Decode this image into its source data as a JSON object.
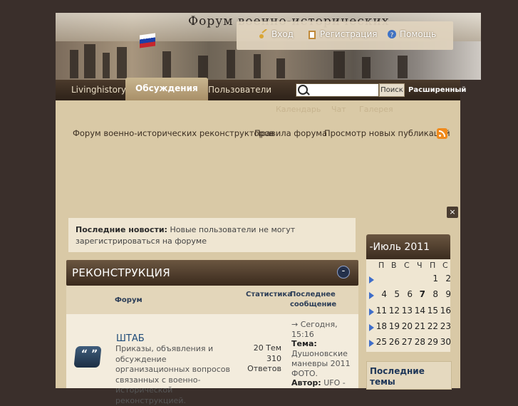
{
  "banner": {
    "title": "Форум военно-исторических"
  },
  "userbar": {
    "login": "Вход",
    "register": "Регистрация",
    "help": "Помощь"
  },
  "nav": {
    "tabs": [
      "Livinghistory",
      "Обсуждения",
      "Пользователи"
    ],
    "search_button": "Поиск",
    "advanced": "Расширенный"
  },
  "subnav": [
    "Календарь",
    "Чат",
    "Галерея"
  ],
  "breadcrumbs": [
    "Форум военно-исторических реконструкторов",
    "Правила форума",
    "Просмотр новых публикаций"
  ],
  "news": {
    "label": "Последние новости:",
    "text": "Новые пользователи не могут зарегистрироваться на форуме"
  },
  "category": {
    "title": "РЕКОНСТРУКЦИЯ",
    "toggle": "-"
  },
  "columns": {
    "forum": "Форум",
    "stats": "Статистика",
    "last": "Последнее сообщение"
  },
  "forum_row": {
    "title": "ШТАБ",
    "description": "Приказы, объявления и обсуждение организационных вопросов связанных с военно-исторической реконструкцией.",
    "topics": "20 Тем",
    "posts": "310 Ответов",
    "last_time": "→ Сегодня, 15:16",
    "last_topic_label": "Тема:",
    "last_topic": "Душоновские маневры 2011 ФОТО.",
    "author_label": "Автор:",
    "author": "UFO -"
  },
  "calendar": {
    "title": "-Июль 2011",
    "weekdays": [
      "П",
      "В",
      "С",
      "Ч",
      "П",
      "С"
    ],
    "weeks": [
      [
        "",
        "",
        "",
        "",
        "1",
        "2"
      ],
      [
        "4",
        "5",
        "6",
        "7",
        "8",
        "9"
      ],
      [
        "11",
        "12",
        "13",
        "14",
        "15",
        "16"
      ],
      [
        "18",
        "19",
        "20",
        "21",
        "22",
        "23"
      ],
      [
        "25",
        "26",
        "27",
        "28",
        "29",
        "30"
      ]
    ],
    "today": "7"
  },
  "sidebar": {
    "latest_topics": "Последние темы"
  },
  "close_label": "×"
}
